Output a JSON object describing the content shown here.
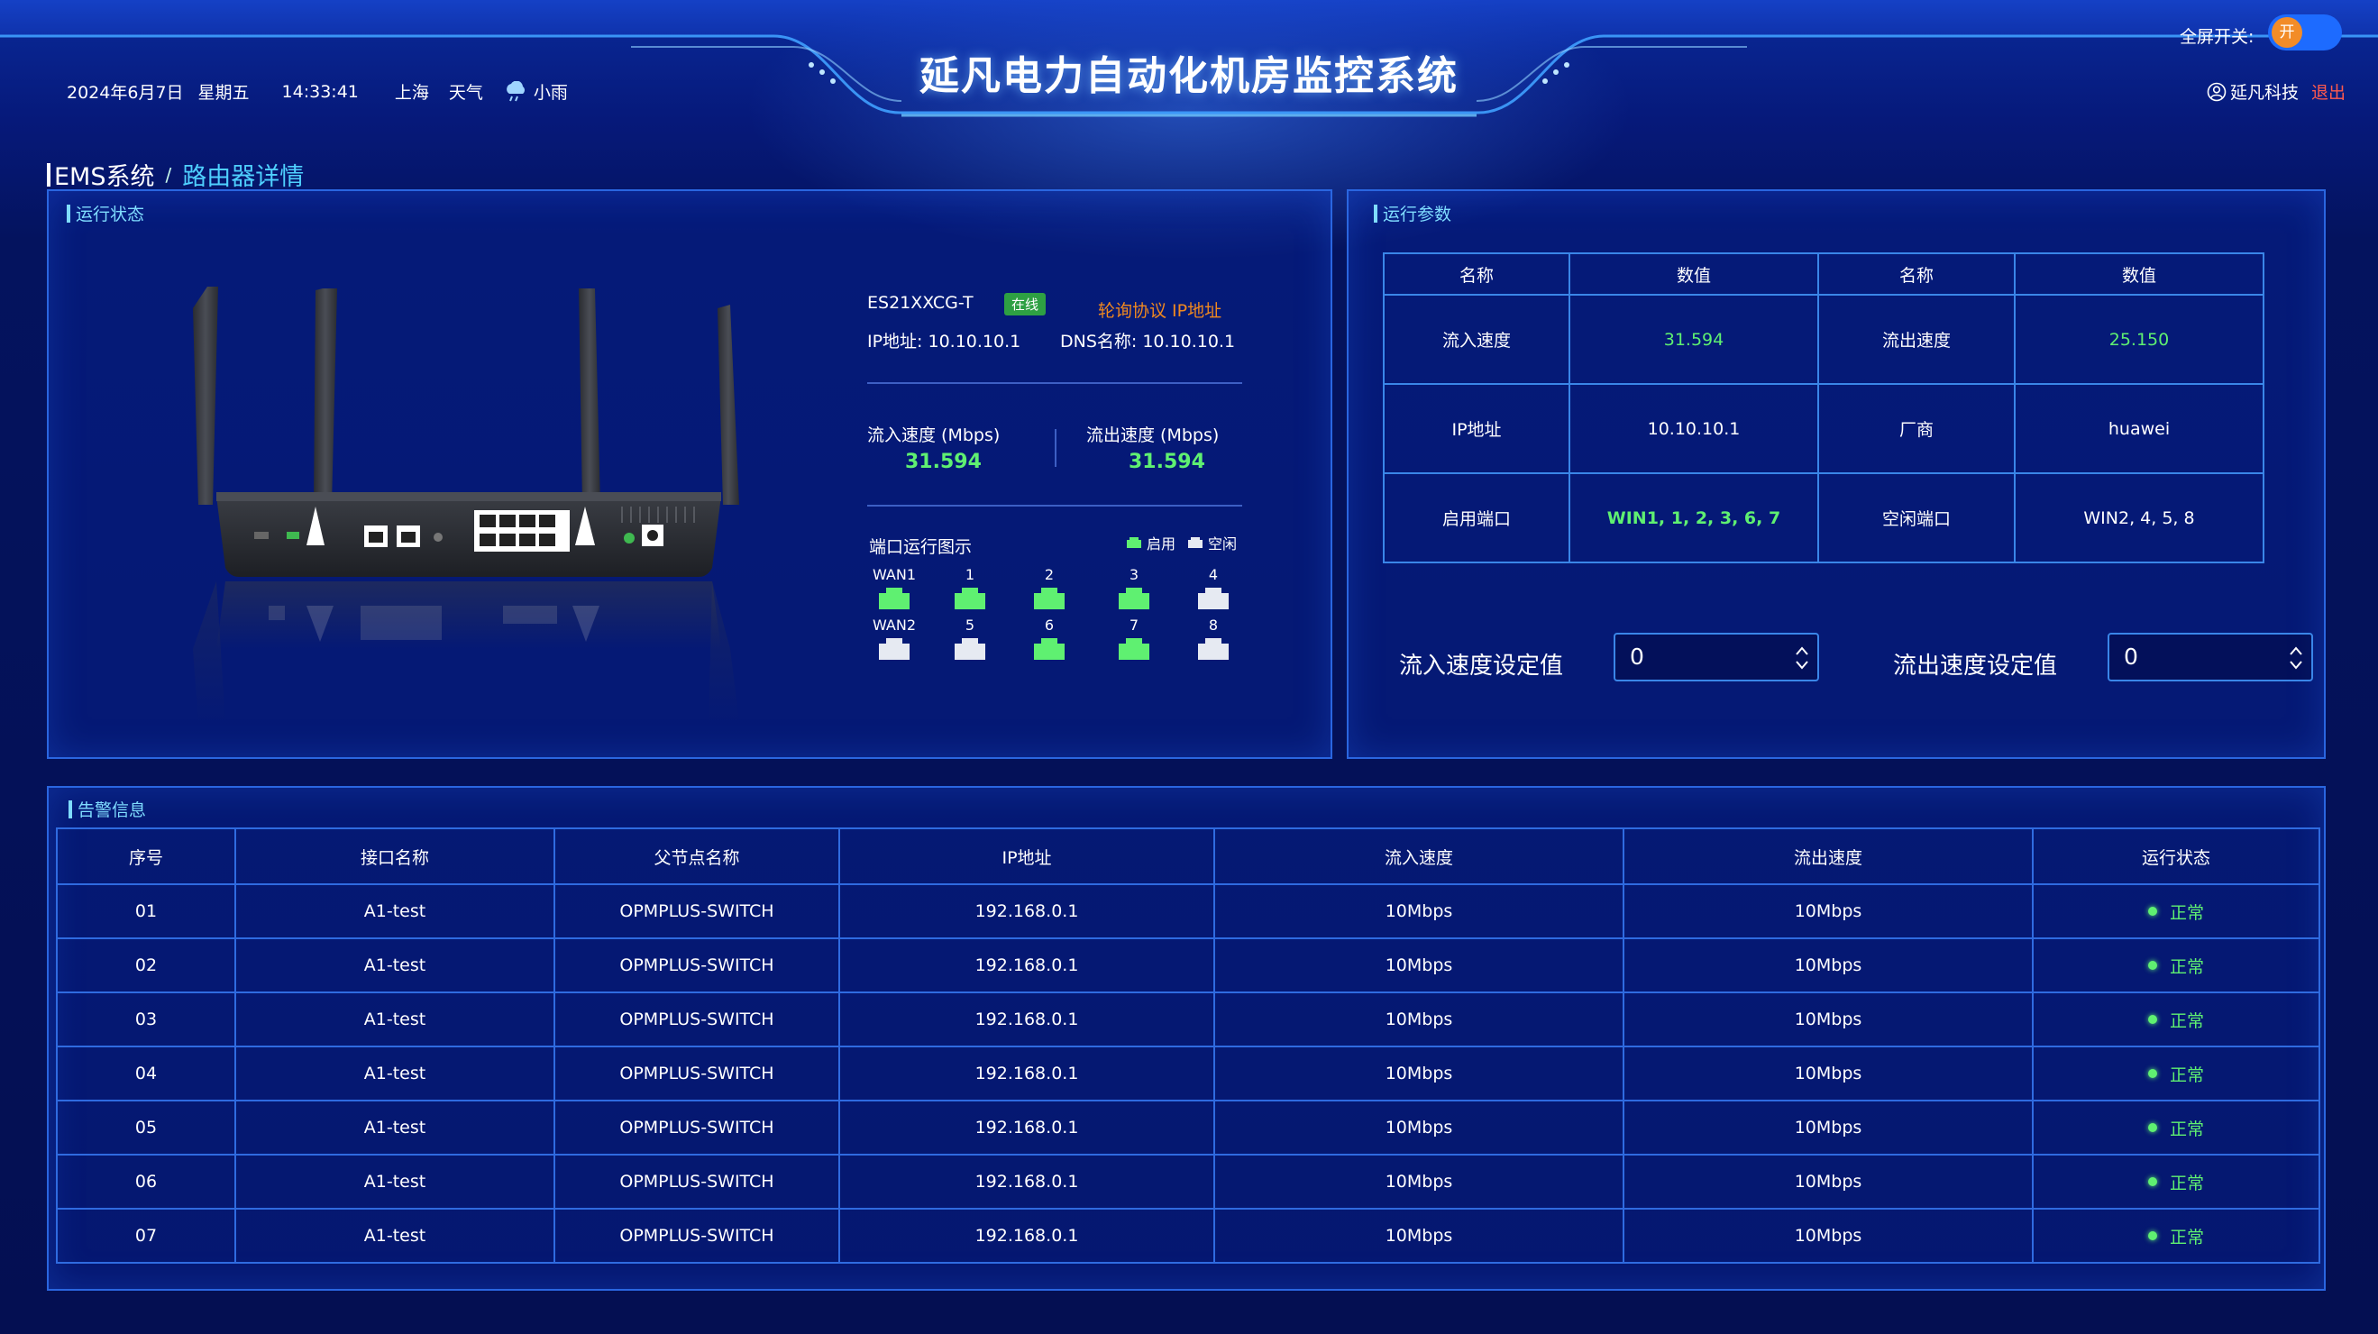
{
  "header": {
    "title": "延凡电力自动化机房监控系统",
    "date": "2024年6月7日",
    "weekday": "星期五",
    "time": "14:33:41",
    "city": "上海",
    "weather_label": "天气",
    "weather": "小雨",
    "fullscreen_label": "全屏开关:",
    "fullscreen_state": "开",
    "company": "延凡科技",
    "logout": "退出"
  },
  "breadcrumb": {
    "root": "EMS系统",
    "separator": "/",
    "current": "路由器详情"
  },
  "status_panel": {
    "title": "运行状态",
    "model": "ES21XXCG-T",
    "online_badge": "在线",
    "poll_link": "轮询协议 IP地址",
    "ip": "IP地址: 10.10.10.1",
    "dns": "DNS名称: 10.10.10.1",
    "in_label": "流入速度 (Mbps)",
    "in_value": "31.594",
    "out_label": "流出速度 (Mbps)",
    "out_value": "31.594",
    "ports_title": "端口运行图示",
    "legend_on": "启用",
    "legend_off": "空闲",
    "ports_row1": [
      {
        "label": "WAN1",
        "state": "on"
      },
      {
        "label": "1",
        "state": "on"
      },
      {
        "label": "2",
        "state": "on"
      },
      {
        "label": "3",
        "state": "on"
      },
      {
        "label": "4",
        "state": "off"
      }
    ],
    "ports_row2": [
      {
        "label": "WAN2",
        "state": "off"
      },
      {
        "label": "5",
        "state": "off"
      },
      {
        "label": "6",
        "state": "on"
      },
      {
        "label": "7",
        "state": "on"
      },
      {
        "label": "8",
        "state": "off"
      }
    ]
  },
  "params_panel": {
    "title": "运行参数",
    "headers": [
      "名称",
      "数值",
      "名称",
      "数值"
    ],
    "rows": [
      [
        "流入速度",
        "31.594",
        "流出速度",
        "25.150"
      ],
      [
        "IP地址",
        "10.10.10.1",
        "厂商",
        "huawei"
      ],
      [
        "启用端口",
        "WIN1, 1, 2, 3, 6, 7",
        "空闲端口",
        "WIN2, 4, 5, 8"
      ]
    ],
    "in_set_label": "流入速度设定值",
    "in_set_value": "0",
    "out_set_label": "流出速度设定值",
    "out_set_value": "0"
  },
  "alarm_panel": {
    "title": "告警信息",
    "headers": [
      "序号",
      "接口名称",
      "父节点名称",
      "IP地址",
      "流入速度",
      "流出速度",
      "运行状态"
    ],
    "rows": [
      [
        "01",
        "A1-test",
        "OPMPLUS-SWITCH",
        "192.168.0.1",
        "10Mbps",
        "10Mbps",
        "正常"
      ],
      [
        "02",
        "A1-test",
        "OPMPLUS-SWITCH",
        "192.168.0.1",
        "10Mbps",
        "10Mbps",
        "正常"
      ],
      [
        "03",
        "A1-test",
        "OPMPLUS-SWITCH",
        "192.168.0.1",
        "10Mbps",
        "10Mbps",
        "正常"
      ],
      [
        "04",
        "A1-test",
        "OPMPLUS-SWITCH",
        "192.168.0.1",
        "10Mbps",
        "10Mbps",
        "正常"
      ],
      [
        "05",
        "A1-test",
        "OPMPLUS-SWITCH",
        "192.168.0.1",
        "10Mbps",
        "10Mbps",
        "正常"
      ],
      [
        "06",
        "A1-test",
        "OPMPLUS-SWITCH",
        "192.168.0.1",
        "10Mbps",
        "10Mbps",
        "正常"
      ],
      [
        "07",
        "A1-test",
        "OPMPLUS-SWITCH",
        "192.168.0.1",
        "10Mbps",
        "10Mbps",
        "正常"
      ]
    ]
  },
  "colors": {
    "accent": "#4fd0ff",
    "ok": "#5ff071",
    "port_off": "#e6eaf2",
    "logout": "#ff5a4e",
    "link": "#f0891f"
  }
}
